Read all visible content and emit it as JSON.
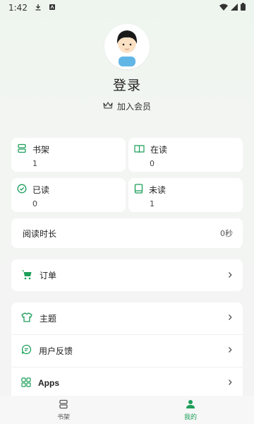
{
  "status_bar": {
    "time": "1:42"
  },
  "profile": {
    "login_label": "登录",
    "member_label": "加入会员"
  },
  "stats": [
    {
      "label": "书架",
      "value": "1",
      "icon": "bookshelf-icon"
    },
    {
      "label": "在读",
      "value": "0",
      "icon": "open-book-icon"
    },
    {
      "label": "已读",
      "value": "0",
      "icon": "check-circle-icon"
    },
    {
      "label": "未读",
      "value": "1",
      "icon": "closed-book-icon"
    }
  ],
  "reading_time": {
    "label": "阅读时长",
    "value": "0秒"
  },
  "orders": {
    "label": "订单",
    "icon": "cart-icon"
  },
  "menu": [
    {
      "label": "主题",
      "icon": "tshirt-icon"
    },
    {
      "label": "用户反馈",
      "icon": "feedback-icon"
    },
    {
      "label": "Apps",
      "icon": "apps-grid-icon"
    }
  ],
  "bottom_nav": [
    {
      "label": "书架",
      "icon": "bookshelf-icon",
      "active": false
    },
    {
      "label": "我的",
      "icon": "person-icon",
      "active": true
    }
  ],
  "colors": {
    "accent": "#1e9e5a",
    "background": "#f3f4f3",
    "card": "#ffffff"
  }
}
